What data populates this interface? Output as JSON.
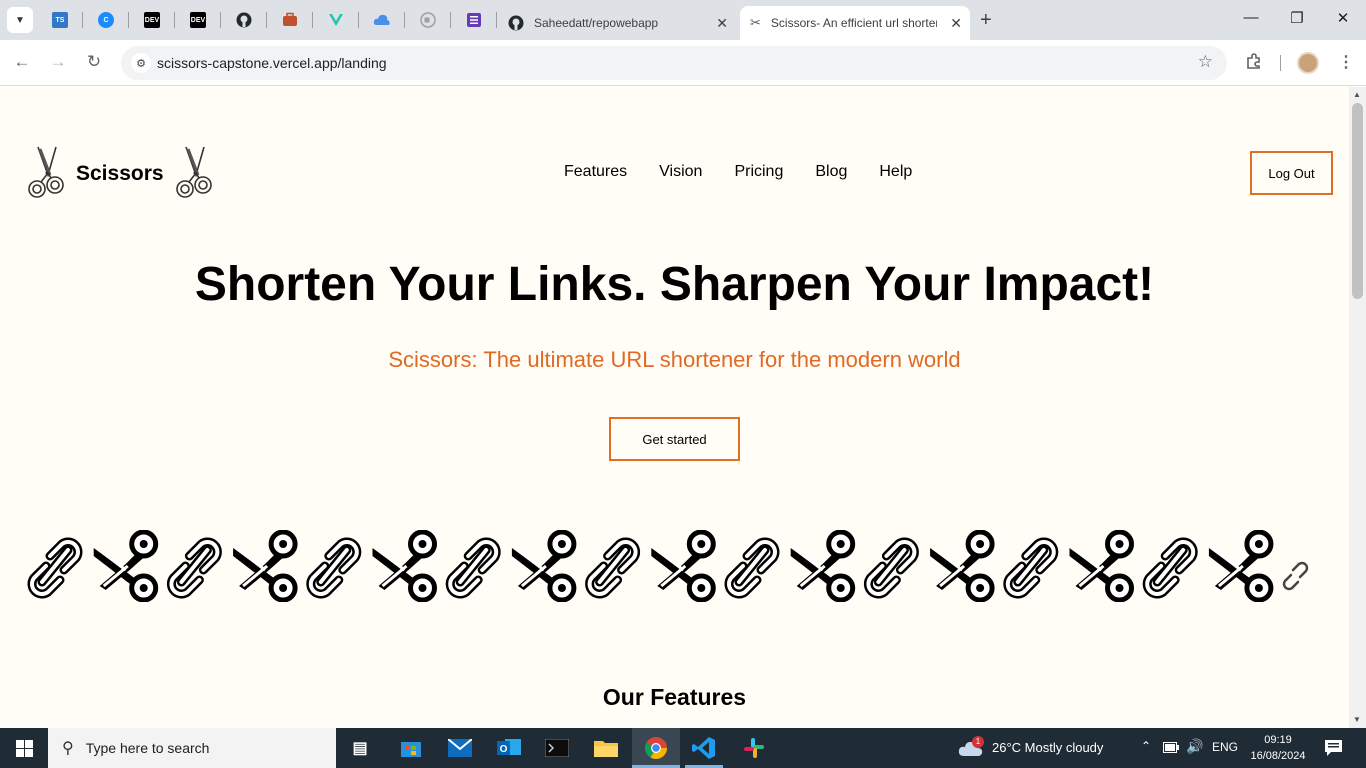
{
  "browser": {
    "pinned_tabs": [
      {
        "icon": "typescript-icon",
        "label": "TS"
      },
      {
        "icon": "chrome-c-icon",
        "label": "C"
      },
      {
        "icon": "dev-icon",
        "label": "DEV"
      },
      {
        "icon": "dev-icon",
        "label": "DEV"
      },
      {
        "icon": "github-icon",
        "label": ""
      },
      {
        "icon": "briefcase-icon",
        "label": ""
      },
      {
        "icon": "vue-icon",
        "label": ""
      },
      {
        "icon": "cloud-upload-icon",
        "label": ""
      },
      {
        "icon": "record-icon",
        "label": ""
      },
      {
        "icon": "form-icon",
        "label": ""
      }
    ],
    "tabs": [
      {
        "title": "Saheedatt/repowebapp",
        "icon": "github-icon"
      },
      {
        "title": "Scissors- An efficient url shortener",
        "icon": "scissors-icon"
      }
    ],
    "url": "scissors-capstone.vercel.app/landing"
  },
  "page": {
    "logo_text": "Scissors",
    "nav": [
      "Features",
      "Vision",
      "Pricing",
      "Blog",
      "Help"
    ],
    "logout_label": "Log Out",
    "hero_title": "Shorten Your Links. Sharpen Your Impact!",
    "hero_subtitle": "Scissors: The ultimate URL shortener for the modern world",
    "cta_label": "Get started",
    "section_title": "Our Features",
    "accent_color": "#e06a22"
  },
  "taskbar": {
    "search_placeholder": "Type here to search",
    "weather": "26°C  Mostly cloudy",
    "weather_badge": "1",
    "language": "ENG",
    "time": "09:19",
    "date": "16/08/2024"
  }
}
